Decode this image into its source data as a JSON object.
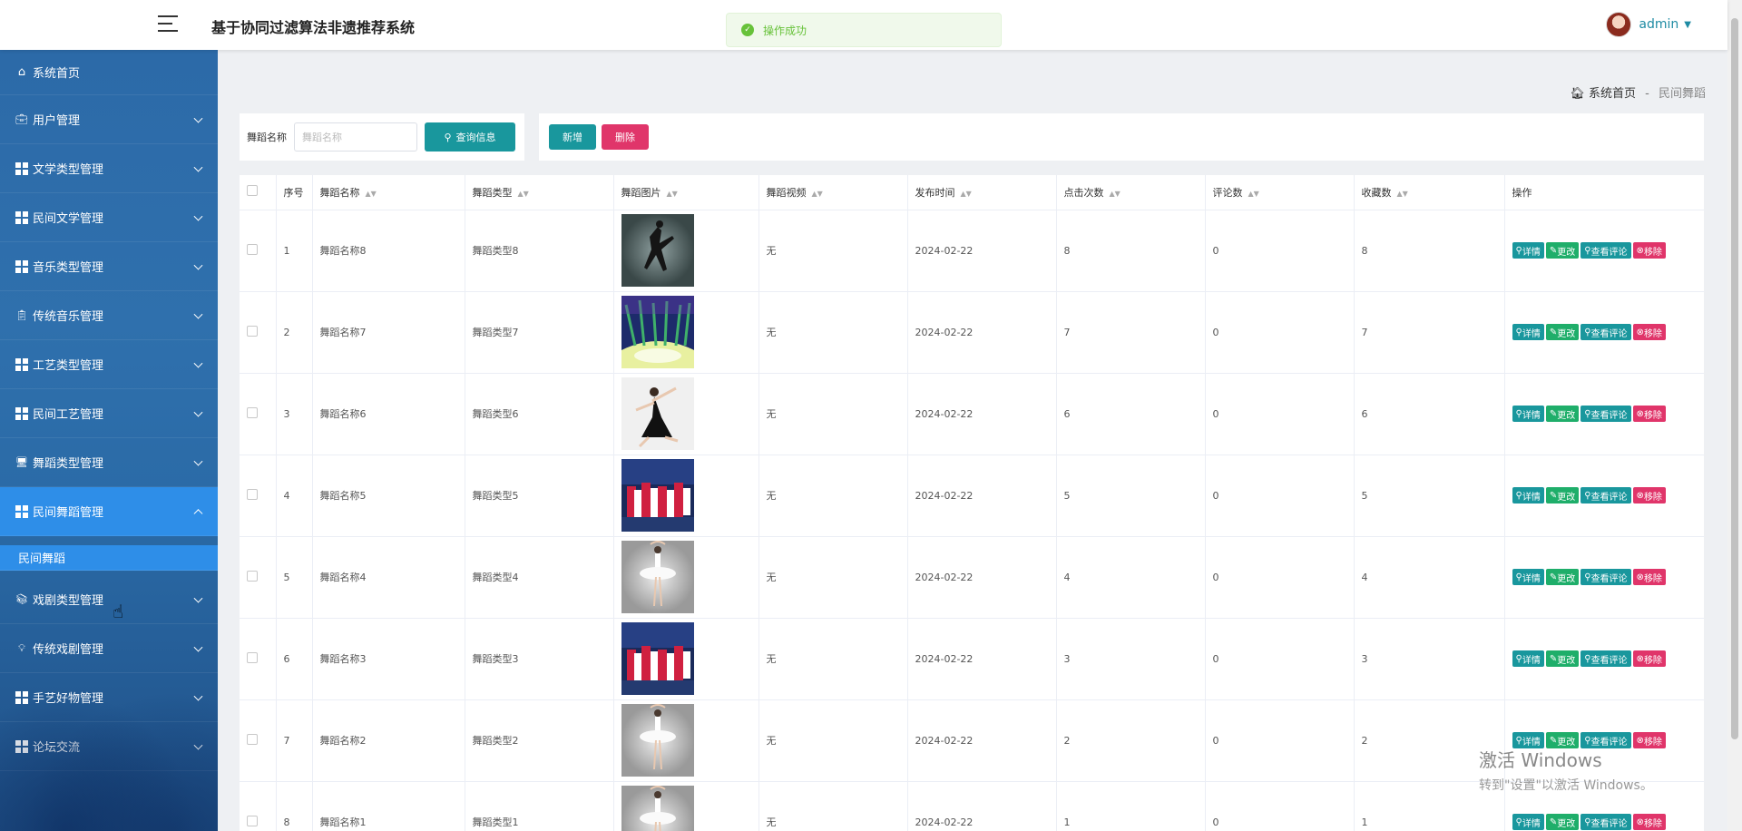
{
  "header": {
    "title": "基于协同过滤算法非遗推荐系统",
    "toast": "操作成功",
    "user": "admin"
  },
  "sidebar": {
    "home": "系统首页",
    "items": [
      {
        "label": "用户管理",
        "icon": "briefcase-icon"
      },
      {
        "label": "文学类型管理",
        "icon": "grid-icon"
      },
      {
        "label": "民间文学管理",
        "icon": "grid-icon"
      },
      {
        "label": "音乐类型管理",
        "icon": "grid-icon"
      },
      {
        "label": "传统音乐管理",
        "icon": "clipboard-icon"
      },
      {
        "label": "工艺类型管理",
        "icon": "grid-icon"
      },
      {
        "label": "民间工艺管理",
        "icon": "grid-icon"
      },
      {
        "label": "舞蹈类型管理",
        "icon": "monitor-icon"
      },
      {
        "label": "民间舞蹈管理",
        "icon": "grid-icon",
        "open": true,
        "sub": "民间舞蹈"
      },
      {
        "label": "戏剧类型管理",
        "icon": "book-icon"
      },
      {
        "label": "传统戏剧管理",
        "icon": "bulb-icon"
      },
      {
        "label": "手艺好物管理",
        "icon": "grid-icon"
      },
      {
        "label": "论坛交流",
        "icon": "grid-icon"
      }
    ]
  },
  "breadcrumb": {
    "home": "系统首页",
    "sep": "-",
    "current": "民间舞蹈"
  },
  "search": {
    "label": "舞蹈名称",
    "placeholder": "舞蹈名称",
    "button": "查询信息"
  },
  "actions": {
    "add": "新增",
    "delete": "删除"
  },
  "table": {
    "headers": [
      "序号",
      "舞蹈名称",
      "舞蹈类型",
      "舞蹈图片",
      "舞蹈视频",
      "发布时间",
      "点击次数",
      "评论数",
      "收藏数",
      "操作"
    ],
    "op_labels": {
      "detail": "详情",
      "edit": "更改",
      "comments": "查看评论",
      "remove": "移除"
    },
    "rows": [
      {
        "no": "1",
        "name": "舞蹈名称8",
        "type": "舞蹈类型8",
        "video": "无",
        "date": "2024-02-22",
        "clicks": "8",
        "comments": "0",
        "favs": "8",
        "img": "dancer-dark"
      },
      {
        "no": "2",
        "name": "舞蹈名称7",
        "type": "舞蹈类型7",
        "video": "无",
        "date": "2024-02-22",
        "clicks": "7",
        "comments": "0",
        "favs": "7",
        "img": "stage-colorful"
      },
      {
        "no": "3",
        "name": "舞蹈名称6",
        "type": "舞蹈类型6",
        "video": "无",
        "date": "2024-02-22",
        "clicks": "6",
        "comments": "0",
        "favs": "6",
        "img": "dancer-light"
      },
      {
        "no": "4",
        "name": "舞蹈名称5",
        "type": "舞蹈类型5",
        "video": "无",
        "date": "2024-02-22",
        "clicks": "5",
        "comments": "0",
        "favs": "5",
        "img": "group-red"
      },
      {
        "no": "5",
        "name": "舞蹈名称4",
        "type": "舞蹈类型4",
        "video": "无",
        "date": "2024-02-22",
        "clicks": "4",
        "comments": "0",
        "favs": "4",
        "img": "ballet-white"
      },
      {
        "no": "6",
        "name": "舞蹈名称3",
        "type": "舞蹈类型3",
        "video": "无",
        "date": "2024-02-22",
        "clicks": "3",
        "comments": "0",
        "favs": "3",
        "img": "group-red"
      },
      {
        "no": "7",
        "name": "舞蹈名称2",
        "type": "舞蹈类型2",
        "video": "无",
        "date": "2024-02-22",
        "clicks": "2",
        "comments": "0",
        "favs": "2",
        "img": "ballet-white"
      },
      {
        "no": "8",
        "name": "舞蹈名称1",
        "type": "舞蹈类型1",
        "video": "无",
        "date": "2024-02-22",
        "clicks": "1",
        "comments": "0",
        "favs": "1",
        "img": "ballet-white"
      }
    ]
  },
  "watermark": {
    "line1": "激活 Windows",
    "line2": "转到\"设置\"以激活 Windows。"
  },
  "colors": {
    "sidebar": "#2c6aa8",
    "sidebar_active": "#2e8ee8",
    "teal": "#19979d",
    "pink": "#e0356a",
    "green": "#1fae6a"
  }
}
